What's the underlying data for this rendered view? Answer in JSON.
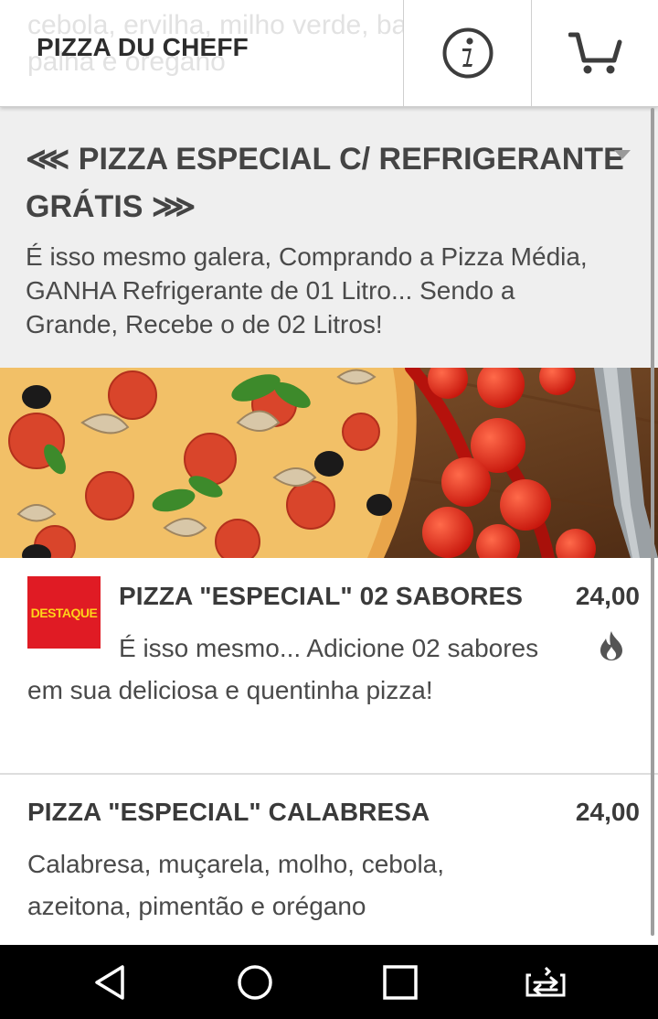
{
  "header": {
    "ghost_text": "cebola, ervilha, milho verde, batata palha e oregano",
    "title": "PIZZA DU CHEFF",
    "info_icon": "info-icon",
    "cart_icon": "cart-icon"
  },
  "promo": {
    "title": "⋘ PIZZA ESPECIAL C/ REFRIGERANTE GRÁTIS ⋙",
    "text": "É isso mesmo galera, Comprando a Pizza Média, GANHA Refrigerante de 01 Litro... Sendo a Grande, Recebe o de 02 Litros!"
  },
  "products": [
    {
      "badge": "DESTAQUE",
      "name": "PIZZA \"ESPECIAL\" 02 SABORES",
      "price": "24,00",
      "description": "É isso mesmo... Adicione 02 sabores em sua deliciosa e quentinha pizza!",
      "icon": "flame-icon"
    },
    {
      "name": "PIZZA \"ESPECIAL\" CALABRESA",
      "price": "24,00",
      "description": "Calabresa, muçarela, molho, cebola, azeitona, pimentão e orégano"
    }
  ],
  "colors": {
    "badge_bg": "#e01b24",
    "badge_text": "#ffd21a",
    "promo_bg": "#efefef",
    "text_dark": "#3a3a3a"
  },
  "navbar": {
    "icons": [
      "back-icon",
      "home-icon",
      "recents-icon",
      "screen-share-icon"
    ]
  }
}
